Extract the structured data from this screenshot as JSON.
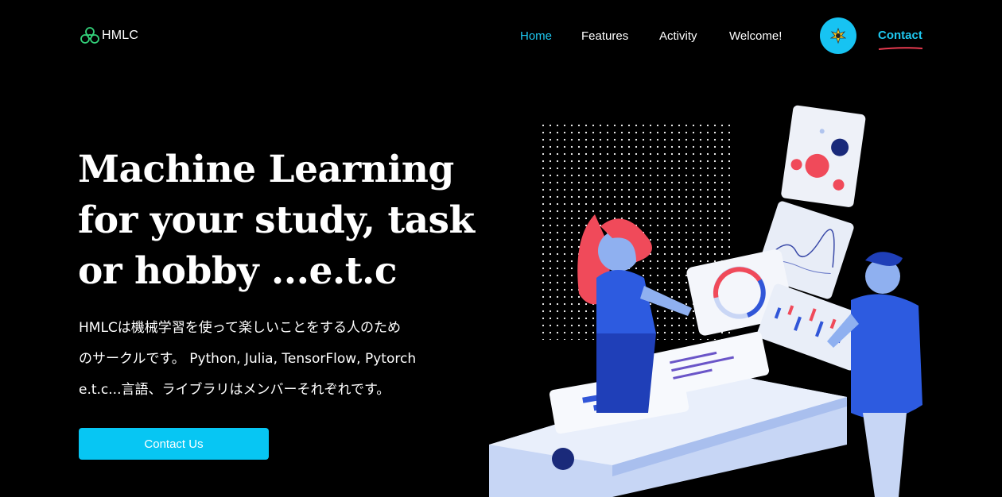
{
  "brand": {
    "name": "HMLC"
  },
  "nav": {
    "items": [
      {
        "label": "Home",
        "active": true
      },
      {
        "label": "Features",
        "active": false
      },
      {
        "label": "Activity",
        "active": false
      },
      {
        "label": "Welcome!",
        "active": false
      }
    ],
    "theme_toggle_icon": "sun-icon",
    "contact_label": "Contact"
  },
  "hero": {
    "title_lines": [
      "Machine Learning",
      "for your study, task",
      "or hobby ...e.t.c"
    ],
    "description_lines": [
      "HMLCは機械学習を使って楽しいことをする人のため",
      "のサークルです。 Python, Julia, TensorFlow, Pytorch",
      "e.t.c...言語、ライブラリはメンバーそれぞれです。"
    ],
    "cta_label": "Contact Us"
  },
  "colors": {
    "accent": "#1ec8f0",
    "button": "#07c6f3",
    "underline": "#e63a4f",
    "background": "#000000"
  }
}
